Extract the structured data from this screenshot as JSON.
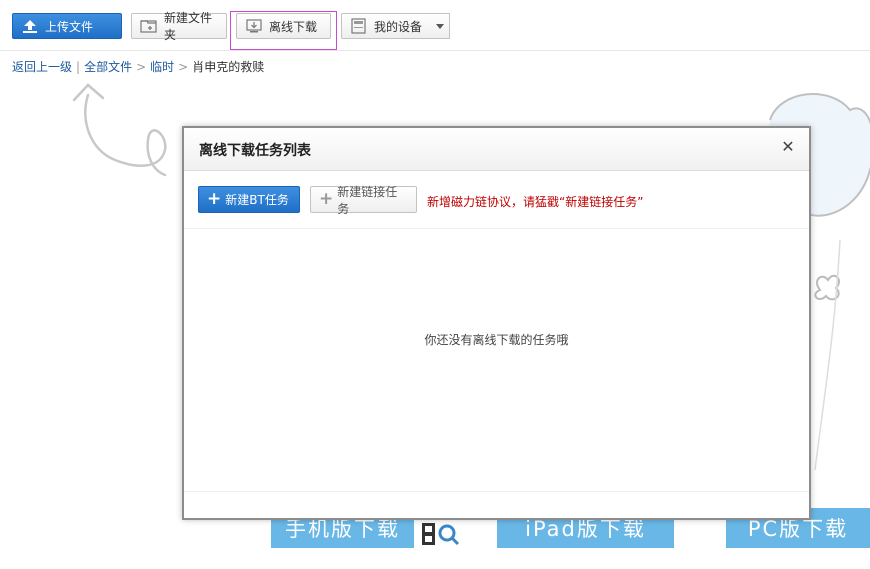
{
  "toolbar": {
    "upload_label": "上传文件",
    "new_folder_label": "新建文件夹",
    "offline_download_label": "离线下载",
    "my_devices_label": "我的设备",
    "accent_color": "#1f6fc8"
  },
  "breadcrumb": {
    "back_label": "返回上一级",
    "divider": "|",
    "items": [
      "全部文件",
      "临时"
    ],
    "separator": ">",
    "current": "肖申克的救赎"
  },
  "background": {
    "banners": [
      "手机版下载",
      "iPad版下载",
      "PC版下载"
    ]
  },
  "modal": {
    "title": "离线下载任务列表",
    "close_icon": "close-icon",
    "new_bt_task_label": "新建BT任务",
    "new_link_task_label": "新建链接任务",
    "notice": "新增磁力链协议，请猛戳“新建链接任务”",
    "notice_color": "#c00000",
    "empty_message": "你还没有离线下载的任务哦"
  }
}
